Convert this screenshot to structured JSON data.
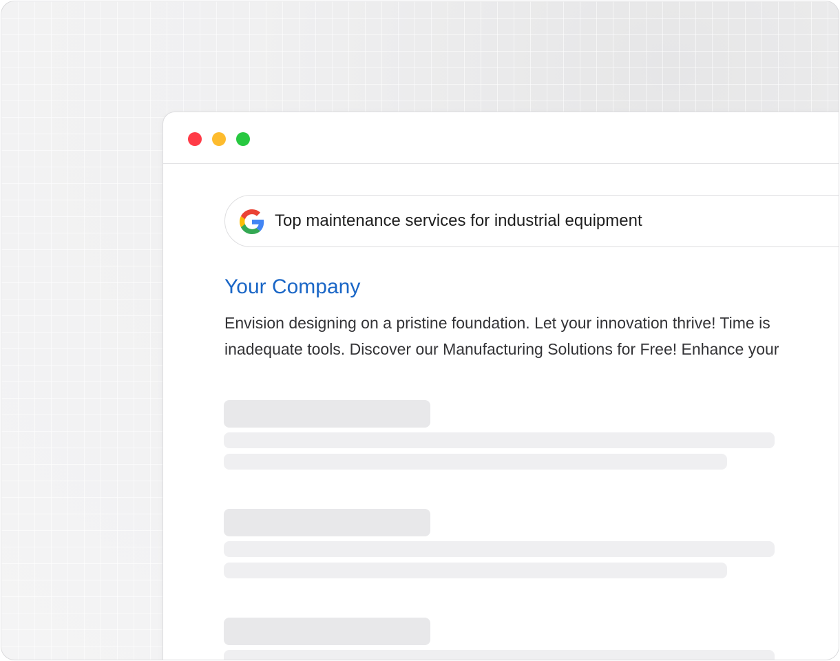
{
  "window": {
    "controls": {
      "close_color": "#ff3b47",
      "minimize_color": "#fdbb2d",
      "maximize_color": "#27c840"
    }
  },
  "search": {
    "icon": "google-g-icon",
    "query": "Top maintenance services for industrial equipment"
  },
  "result": {
    "title": "Your Company",
    "title_color": "#1a66c6",
    "snippet_lines": [
      "Envision designing on a pristine foundation. Let your innovation thrive! Time is",
      "inadequate tools. Discover our Manufacturing Solutions for Free! Enhance your"
    ]
  },
  "placeholders": {
    "count": 3,
    "color": "#e8e8ea"
  }
}
